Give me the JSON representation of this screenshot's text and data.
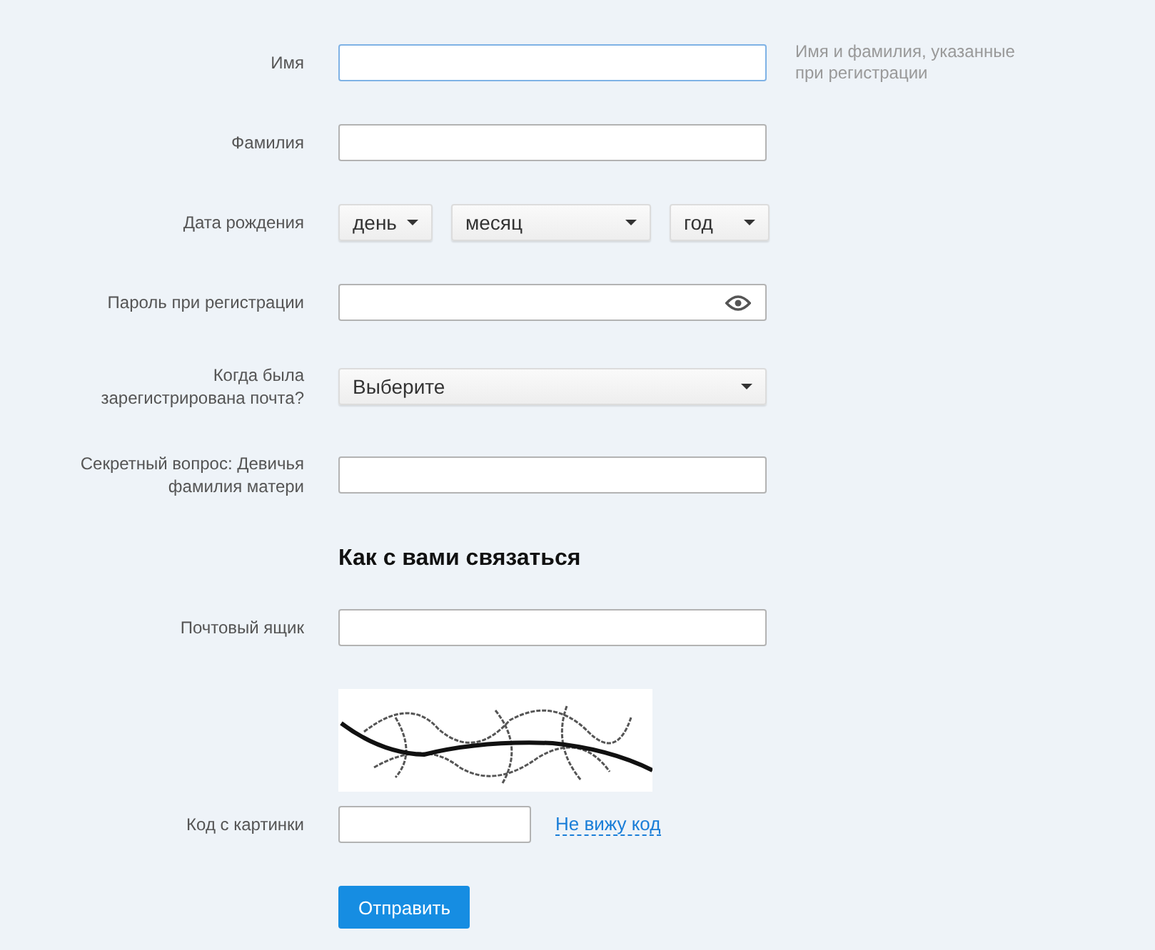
{
  "rows": [
    {
      "kind": "text",
      "label": "Имя",
      "focused": true,
      "hint": "Имя и фамилия, указанные при регистрации"
    },
    {
      "kind": "text",
      "label": "Фамилия",
      "focused": false
    },
    {
      "kind": "date",
      "label": "Дата рождения",
      "selects": [
        {
          "value": "день"
        },
        {
          "value": "месяц"
        },
        {
          "value": "год"
        }
      ]
    },
    {
      "kind": "password",
      "label": "Пароль при регистрации",
      "focused": false
    },
    {
      "kind": "select",
      "label": "Когда была зарегистрирована почта?",
      "value": "Выберите"
    },
    {
      "kind": "text",
      "label": "Секретный вопрос: Девичья фамилия матери",
      "focused": false
    }
  ],
  "contact": {
    "heading": "Как с вами связаться",
    "mailbox_label": "Почтовый ящик",
    "code_label": "Код с картинки",
    "cant_see_link": "Не вижу код",
    "submit": "Отправить"
  }
}
